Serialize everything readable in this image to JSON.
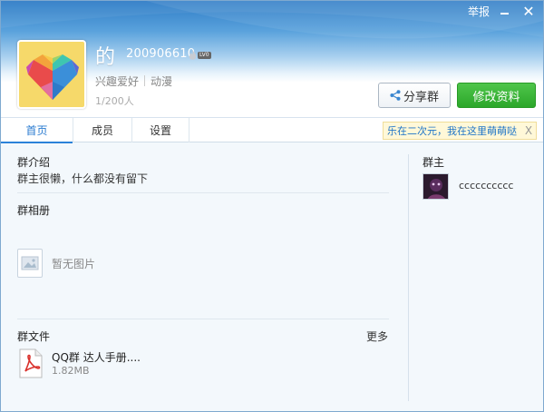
{
  "window": {
    "report_label": "举报",
    "minimize_icon": "minimize-icon",
    "close_label": "✕"
  },
  "group": {
    "name": "的",
    "id": "200906610",
    "level_badge": "LV0",
    "tag_category": "兴趣爱好",
    "tag_sub": "动漫",
    "member_count": "1/200人"
  },
  "actions": {
    "share_label": "分享群",
    "edit_label": "修改资料"
  },
  "tabs": [
    {
      "label": "首页",
      "active": true
    },
    {
      "label": "成员",
      "active": false
    },
    {
      "label": "设置",
      "active": false
    }
  ],
  "notice": {
    "text": "乐在二次元，我在这里萌萌哒",
    "close_label": "X"
  },
  "intro": {
    "title": "群介绍",
    "text": "群主很懒，什么都没有留下"
  },
  "album": {
    "title": "群相册",
    "empty_text": "暂无图片"
  },
  "files": {
    "title": "群文件",
    "more_label": "更多",
    "items": [
      {
        "name": "QQ群 达人手册....",
        "size": "1.82MB",
        "icon": "pdf-icon"
      }
    ]
  },
  "owner": {
    "title": "群主",
    "name": "cccccccccc"
  },
  "colors": {
    "accent": "#2b82d9",
    "edit_button": "#3bb539",
    "notice_bg": "#fff8d8",
    "logo_bg": "#f6d96a"
  }
}
